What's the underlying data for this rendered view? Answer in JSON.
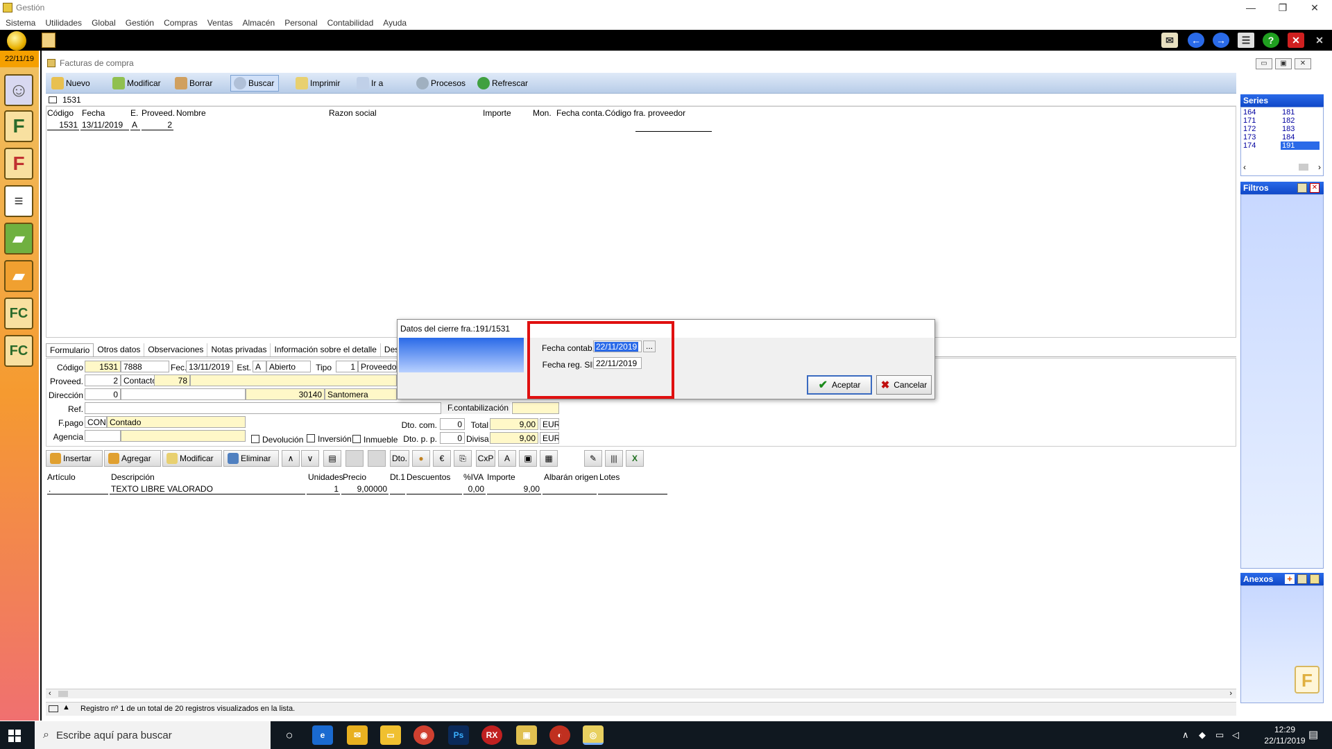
{
  "window": {
    "title": "Gestión"
  },
  "menu": [
    "Sistema",
    "Utilidades",
    "Global",
    "Gestión",
    "Compras",
    "Ventas",
    "Almacén",
    "Personal",
    "Contabilidad",
    "Ayuda"
  ],
  "date_badge": "22/11/19",
  "subwindow": {
    "title": "Facturas de compra"
  },
  "toolbar": {
    "nuevo": "Nuevo",
    "modificar": "Modificar",
    "borrar": "Borrar",
    "buscar": "Buscar",
    "imprimir": "Imprimir",
    "ir_a": "Ir a",
    "procesos": "Procesos",
    "refrescar": "Refrescar"
  },
  "record_search": "1531",
  "grid": {
    "headers": {
      "codigo": "Código",
      "fecha": "Fecha",
      "e": "E.",
      "proveed": "Proveed.",
      "nombre": "Nombre",
      "razon": "Razon social",
      "importe": "Importe",
      "mon": "Mon.",
      "fecha_conta": "Fecha conta.",
      "codigo_fra": "Código fra. proveedor"
    },
    "row": {
      "codigo": "1531",
      "fecha": "13/11/2019",
      "e": "A",
      "proveed": "2"
    }
  },
  "series": {
    "title": "Series",
    "rows": [
      [
        "164",
        "181"
      ],
      [
        "171",
        "182"
      ],
      [
        "172",
        "183"
      ],
      [
        "173",
        "184"
      ],
      [
        "174",
        "191"
      ]
    ],
    "selected": "191"
  },
  "filtros": {
    "title": "Filtros"
  },
  "anexos": {
    "title": "Anexos"
  },
  "tabs": [
    "Formulario",
    "Otros datos",
    "Observaciones",
    "Notas privadas",
    "Información sobre el detalle",
    "Descuentos e"
  ],
  "form": {
    "codigo_label": "Código",
    "codigo": "1531",
    "codigo2": "7888",
    "fec_label": "Fec.",
    "fec": "13/11/2019",
    "est_label": "Est.",
    "est": "A",
    "estado": "Abierto",
    "tipo_label": "Tipo",
    "tipo": "1",
    "tipo_desc": "Proveedor",
    "proveed_label": "Proveed.",
    "proveed": "2",
    "contacto_label": "Contacto",
    "contacto": "78",
    "direccion_label": "Dirección",
    "direccion": "0",
    "cp": "30140",
    "poblacion": "Santomera",
    "ref_label": "Ref.",
    "fpago_label": "F.pago",
    "fpago_code": "CON",
    "fpago_desc": "Contado",
    "agencia_label": "Agencia",
    "fcontab_label": "F.contabilización",
    "devolucion": "Devolución",
    "inversion": "Inversión",
    "inmueble": "Inmueble",
    "dto_com_label": "Dto. com.",
    "dto_com": "0",
    "dto_pp_label": "Dto. p. p.",
    "dto_pp": "0",
    "total_label": "Total",
    "total": "9,00",
    "total_cur": "EUR",
    "divisa_label": "Divisa",
    "divisa": "9,00",
    "divisa_cur": "EUR"
  },
  "lines_toolbar": {
    "insertar": "Insertar",
    "agregar": "Agregar",
    "modificar": "Modificar",
    "eliminar": "Eliminar",
    "dto": "Dto.",
    "cxp": "CxP"
  },
  "lines": {
    "headers": {
      "articulo": "Artículo",
      "descripcion": "Descripción",
      "unidades": "Unidades",
      "precio": "Precio",
      "dt1": "Dt.1",
      "descuentos": "Descuentos",
      "iva": "%IVA",
      "importe": "Importe",
      "albaran": "Albarán origen",
      "lotes": "Lotes"
    },
    "row": {
      "articulo": ".",
      "descripcion": "TEXTO LIBRE VALORADO",
      "unidades": "1",
      "precio": "9,00000",
      "iva": "0,00",
      "importe": "9,00"
    }
  },
  "status": "Registro nº 1 de un total de 20 registros visualizados en la lista.",
  "dialog": {
    "title": "Datos del cierre fra.:191/1531",
    "fecha_contab_label": "Fecha contab.",
    "fecha_contab": "22/11/2019",
    "fecha_sii_label": "Fecha reg. SII",
    "fecha_sii": "22/11/2019",
    "browse": "...",
    "accept": "Aceptar",
    "cancel": "Cancelar"
  },
  "taskbar": {
    "search_placeholder": "Escribe aquí para buscar",
    "time": "12:29",
    "date": "22/11/2019"
  },
  "colors": {
    "accent": "#2a6ae8",
    "highlight": "#e01010",
    "yellow_field": "#fff8c8"
  }
}
